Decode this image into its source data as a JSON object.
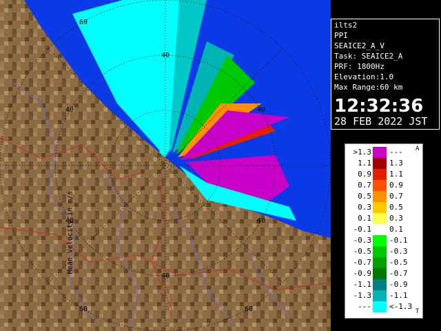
{
  "info": {
    "radar_name": "ilts2",
    "product": "PPI",
    "scan_name": "SEAICE2_A_V",
    "task": "Task: SEAICE2_A",
    "prf": "PRF: 1800Hz",
    "elevation": "Elevation:1.0",
    "max_range": "Max Range:60 km",
    "time": "12:32:36",
    "date": "28 FEB 2022 JST"
  },
  "range_rings": {
    "labels": [
      "60",
      "40",
      "40",
      "40",
      "40",
      "40",
      "60",
      "40",
      "60"
    ]
  },
  "legend": {
    "title": "Mean Velocity in m/s",
    "corner_top": "A",
    "corner_bottom": "T",
    "rows": [
      {
        "left": ">1.3",
        "right": "---",
        "color": "#c800c8"
      },
      {
        "left": "1.1",
        "right": "1.3",
        "color": "#a00000"
      },
      {
        "left": "0.9",
        "right": "1.1",
        "color": "#e02000"
      },
      {
        "left": "0.7",
        "right": "0.9",
        "color": "#ff5000"
      },
      {
        "left": "0.5",
        "right": "0.7",
        "color": "#ff9000"
      },
      {
        "left": "0.3",
        "right": "0.5",
        "color": "#ffc800"
      },
      {
        "left": "0.1",
        "right": "0.3",
        "color": "#ffff50"
      },
      {
        "left": "-0.1",
        "right": "0.1",
        "color": "#ffffff"
      },
      {
        "left": "-0.3",
        "right": "-0.1",
        "color": "#00ff00"
      },
      {
        "left": "-0.5",
        "right": "-0.3",
        "color": "#00c800"
      },
      {
        "left": "-0.7",
        "right": "-0.5",
        "color": "#00a000"
      },
      {
        "left": "-0.9",
        "right": "-0.7",
        "color": "#007800"
      },
      {
        "left": "-1.1",
        "right": "-0.9",
        "color": "#008080"
      },
      {
        "left": "-1.3",
        "right": "-1.1",
        "color": "#00b4b4"
      },
      {
        "left": "---",
        "right": "<-1.3",
        "color": "#00ffff"
      }
    ]
  },
  "colors": {
    "sea": "#0a3ae6",
    "land": "#8c6a42",
    "rings": "#000000"
  }
}
